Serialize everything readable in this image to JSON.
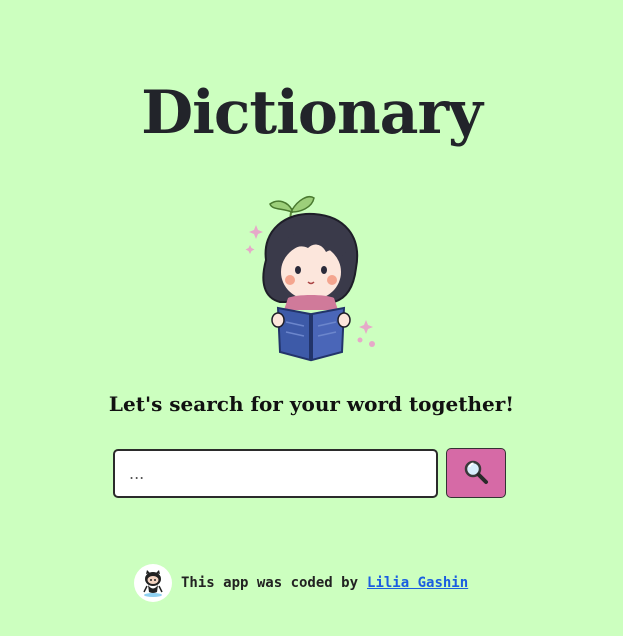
{
  "header": {
    "title": "Dictionary"
  },
  "hero": {
    "tagline": "Let's search for your word together!"
  },
  "search": {
    "placeholder": "...",
    "value": "",
    "button_icon": "magnifying-glass-icon"
  },
  "footer": {
    "text": "This app was coded by",
    "author": "Lilia Gashin",
    "avatar_icon": "github-octocat-icon"
  },
  "colors": {
    "background": "#ccffbf",
    "button": "#d66aa6",
    "link": "#1a5ee0",
    "title": "#22242a"
  }
}
